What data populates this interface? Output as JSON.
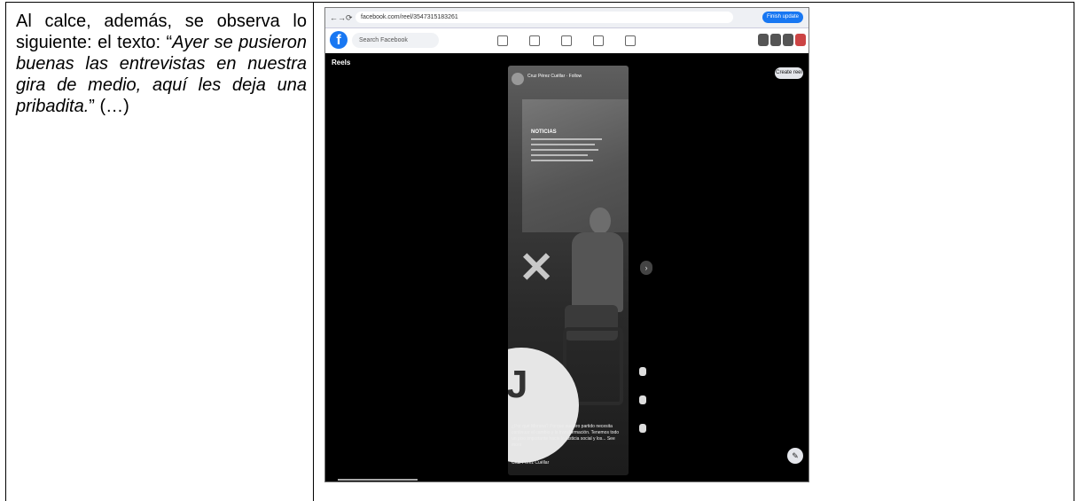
{
  "document": {
    "caption_text": [
      {
        "text": "Al calce, además, se observa lo siguiente: el texto: “",
        "italic": false
      },
      {
        "text": "Ayer se pusieron buenas las entrevistas en nuestra gira de medio, aquí les deja una pribadita.",
        "italic": true
      },
      {
        "text": "” (…)",
        "italic": false
      }
    ]
  },
  "screenshot": {
    "url": "facebook.com/reel/3547315183261",
    "top_pill": "Finish update",
    "search_placeholder": "Search Facebook",
    "reels_label": "Reels",
    "create_reel": "Create reel",
    "profile_name": "Cruz Pérez Cuéllar · Follow",
    "board_title": "NOTICIAS",
    "reel_caption": "¿Por qué Morena? Porque nuestro partido necesita continuar el cambio y la transformación. Tenemos todo un piso importante hacia la justicia social y los... See more",
    "reel_author": "Cruz Pérez Cuéllar",
    "next_glyph": "›",
    "fab_glyph": "✎"
  }
}
